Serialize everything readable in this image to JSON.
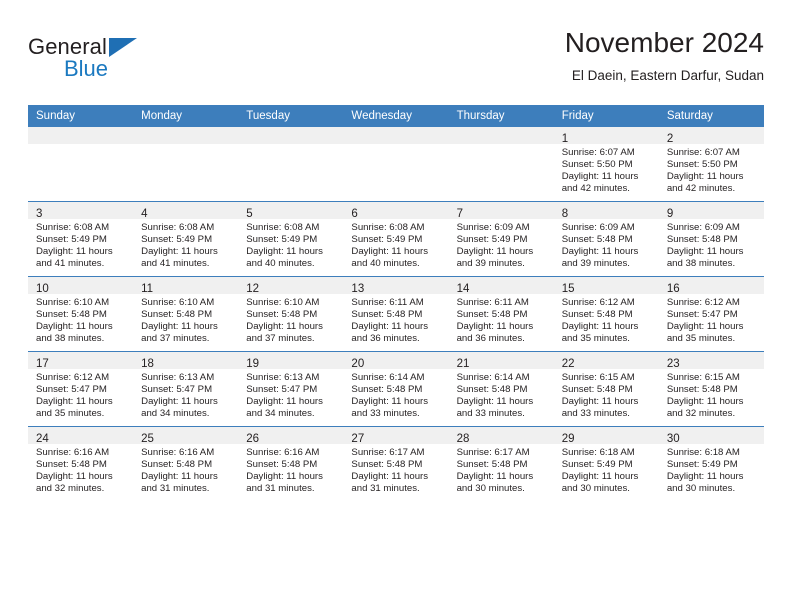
{
  "brand": {
    "name_part1": "General",
    "name_part2": "Blue",
    "logo_icon": "triangle-logo-icon"
  },
  "header": {
    "month_title": "November 2024",
    "location": "El Daein, Eastern Darfur, Sudan"
  },
  "colors": {
    "header_blue": "#3d7ebc",
    "brand_blue": "#1b79c0",
    "daynum_band": "#f0f0f0",
    "text": "#231f20"
  },
  "calendar": {
    "weekday_headers": [
      "Sunday",
      "Monday",
      "Tuesday",
      "Wednesday",
      "Thursday",
      "Friday",
      "Saturday"
    ],
    "weeks": [
      [
        {
          "day": "",
          "empty": true
        },
        {
          "day": "",
          "empty": true
        },
        {
          "day": "",
          "empty": true
        },
        {
          "day": "",
          "empty": true
        },
        {
          "day": "",
          "empty": true
        },
        {
          "day": "1",
          "sunrise": "Sunrise: 6:07 AM",
          "sunset": "Sunset: 5:50 PM",
          "daylight_line1": "Daylight: 11 hours",
          "daylight_line2": "and 42 minutes."
        },
        {
          "day": "2",
          "sunrise": "Sunrise: 6:07 AM",
          "sunset": "Sunset: 5:50 PM",
          "daylight_line1": "Daylight: 11 hours",
          "daylight_line2": "and 42 minutes."
        }
      ],
      [
        {
          "day": "3",
          "sunrise": "Sunrise: 6:08 AM",
          "sunset": "Sunset: 5:49 PM",
          "daylight_line1": "Daylight: 11 hours",
          "daylight_line2": "and 41 minutes."
        },
        {
          "day": "4",
          "sunrise": "Sunrise: 6:08 AM",
          "sunset": "Sunset: 5:49 PM",
          "daylight_line1": "Daylight: 11 hours",
          "daylight_line2": "and 41 minutes."
        },
        {
          "day": "5",
          "sunrise": "Sunrise: 6:08 AM",
          "sunset": "Sunset: 5:49 PM",
          "daylight_line1": "Daylight: 11 hours",
          "daylight_line2": "and 40 minutes."
        },
        {
          "day": "6",
          "sunrise": "Sunrise: 6:08 AM",
          "sunset": "Sunset: 5:49 PM",
          "daylight_line1": "Daylight: 11 hours",
          "daylight_line2": "and 40 minutes."
        },
        {
          "day": "7",
          "sunrise": "Sunrise: 6:09 AM",
          "sunset": "Sunset: 5:49 PM",
          "daylight_line1": "Daylight: 11 hours",
          "daylight_line2": "and 39 minutes."
        },
        {
          "day": "8",
          "sunrise": "Sunrise: 6:09 AM",
          "sunset": "Sunset: 5:48 PM",
          "daylight_line1": "Daylight: 11 hours",
          "daylight_line2": "and 39 minutes."
        },
        {
          "day": "9",
          "sunrise": "Sunrise: 6:09 AM",
          "sunset": "Sunset: 5:48 PM",
          "daylight_line1": "Daylight: 11 hours",
          "daylight_line2": "and 38 minutes."
        }
      ],
      [
        {
          "day": "10",
          "sunrise": "Sunrise: 6:10 AM",
          "sunset": "Sunset: 5:48 PM",
          "daylight_line1": "Daylight: 11 hours",
          "daylight_line2": "and 38 minutes."
        },
        {
          "day": "11",
          "sunrise": "Sunrise: 6:10 AM",
          "sunset": "Sunset: 5:48 PM",
          "daylight_line1": "Daylight: 11 hours",
          "daylight_line2": "and 37 minutes."
        },
        {
          "day": "12",
          "sunrise": "Sunrise: 6:10 AM",
          "sunset": "Sunset: 5:48 PM",
          "daylight_line1": "Daylight: 11 hours",
          "daylight_line2": "and 37 minutes."
        },
        {
          "day": "13",
          "sunrise": "Sunrise: 6:11 AM",
          "sunset": "Sunset: 5:48 PM",
          "daylight_line1": "Daylight: 11 hours",
          "daylight_line2": "and 36 minutes."
        },
        {
          "day": "14",
          "sunrise": "Sunrise: 6:11 AM",
          "sunset": "Sunset: 5:48 PM",
          "daylight_line1": "Daylight: 11 hours",
          "daylight_line2": "and 36 minutes."
        },
        {
          "day": "15",
          "sunrise": "Sunrise: 6:12 AM",
          "sunset": "Sunset: 5:48 PM",
          "daylight_line1": "Daylight: 11 hours",
          "daylight_line2": "and 35 minutes."
        },
        {
          "day": "16",
          "sunrise": "Sunrise: 6:12 AM",
          "sunset": "Sunset: 5:47 PM",
          "daylight_line1": "Daylight: 11 hours",
          "daylight_line2": "and 35 minutes."
        }
      ],
      [
        {
          "day": "17",
          "sunrise": "Sunrise: 6:12 AM",
          "sunset": "Sunset: 5:47 PM",
          "daylight_line1": "Daylight: 11 hours",
          "daylight_line2": "and 35 minutes."
        },
        {
          "day": "18",
          "sunrise": "Sunrise: 6:13 AM",
          "sunset": "Sunset: 5:47 PM",
          "daylight_line1": "Daylight: 11 hours",
          "daylight_line2": "and 34 minutes."
        },
        {
          "day": "19",
          "sunrise": "Sunrise: 6:13 AM",
          "sunset": "Sunset: 5:47 PM",
          "daylight_line1": "Daylight: 11 hours",
          "daylight_line2": "and 34 minutes."
        },
        {
          "day": "20",
          "sunrise": "Sunrise: 6:14 AM",
          "sunset": "Sunset: 5:48 PM",
          "daylight_line1": "Daylight: 11 hours",
          "daylight_line2": "and 33 minutes."
        },
        {
          "day": "21",
          "sunrise": "Sunrise: 6:14 AM",
          "sunset": "Sunset: 5:48 PM",
          "daylight_line1": "Daylight: 11 hours",
          "daylight_line2": "and 33 minutes."
        },
        {
          "day": "22",
          "sunrise": "Sunrise: 6:15 AM",
          "sunset": "Sunset: 5:48 PM",
          "daylight_line1": "Daylight: 11 hours",
          "daylight_line2": "and 33 minutes."
        },
        {
          "day": "23",
          "sunrise": "Sunrise: 6:15 AM",
          "sunset": "Sunset: 5:48 PM",
          "daylight_line1": "Daylight: 11 hours",
          "daylight_line2": "and 32 minutes."
        }
      ],
      [
        {
          "day": "24",
          "sunrise": "Sunrise: 6:16 AM",
          "sunset": "Sunset: 5:48 PM",
          "daylight_line1": "Daylight: 11 hours",
          "daylight_line2": "and 32 minutes."
        },
        {
          "day": "25",
          "sunrise": "Sunrise: 6:16 AM",
          "sunset": "Sunset: 5:48 PM",
          "daylight_line1": "Daylight: 11 hours",
          "daylight_line2": "and 31 minutes."
        },
        {
          "day": "26",
          "sunrise": "Sunrise: 6:16 AM",
          "sunset": "Sunset: 5:48 PM",
          "daylight_line1": "Daylight: 11 hours",
          "daylight_line2": "and 31 minutes."
        },
        {
          "day": "27",
          "sunrise": "Sunrise: 6:17 AM",
          "sunset": "Sunset: 5:48 PM",
          "daylight_line1": "Daylight: 11 hours",
          "daylight_line2": "and 31 minutes."
        },
        {
          "day": "28",
          "sunrise": "Sunrise: 6:17 AM",
          "sunset": "Sunset: 5:48 PM",
          "daylight_line1": "Daylight: 11 hours",
          "daylight_line2": "and 30 minutes."
        },
        {
          "day": "29",
          "sunrise": "Sunrise: 6:18 AM",
          "sunset": "Sunset: 5:49 PM",
          "daylight_line1": "Daylight: 11 hours",
          "daylight_line2": "and 30 minutes."
        },
        {
          "day": "30",
          "sunrise": "Sunrise: 6:18 AM",
          "sunset": "Sunset: 5:49 PM",
          "daylight_line1": "Daylight: 11 hours",
          "daylight_line2": "and 30 minutes."
        }
      ]
    ]
  }
}
